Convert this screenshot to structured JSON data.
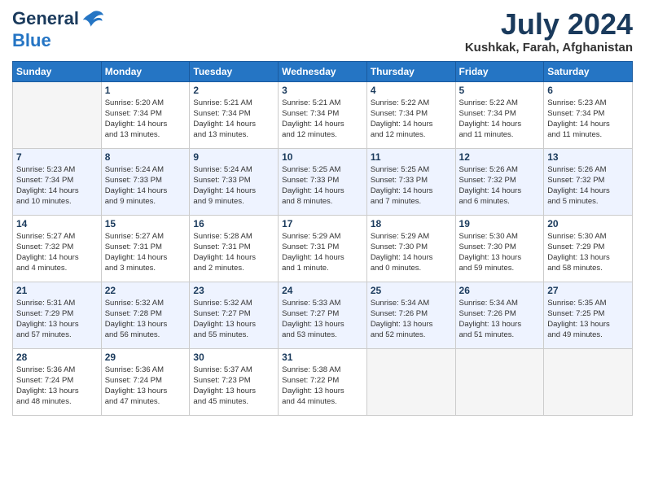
{
  "header": {
    "logo_line1": "General",
    "logo_line2": "Blue",
    "month_year": "July 2024",
    "location": "Kushkak, Farah, Afghanistan"
  },
  "days_of_week": [
    "Sunday",
    "Monday",
    "Tuesday",
    "Wednesday",
    "Thursday",
    "Friday",
    "Saturday"
  ],
  "weeks": [
    [
      {
        "day": "",
        "info": ""
      },
      {
        "day": "1",
        "info": "Sunrise: 5:20 AM\nSunset: 7:34 PM\nDaylight: 14 hours\nand 13 minutes."
      },
      {
        "day": "2",
        "info": "Sunrise: 5:21 AM\nSunset: 7:34 PM\nDaylight: 14 hours\nand 13 minutes."
      },
      {
        "day": "3",
        "info": "Sunrise: 5:21 AM\nSunset: 7:34 PM\nDaylight: 14 hours\nand 12 minutes."
      },
      {
        "day": "4",
        "info": "Sunrise: 5:22 AM\nSunset: 7:34 PM\nDaylight: 14 hours\nand 12 minutes."
      },
      {
        "day": "5",
        "info": "Sunrise: 5:22 AM\nSunset: 7:34 PM\nDaylight: 14 hours\nand 11 minutes."
      },
      {
        "day": "6",
        "info": "Sunrise: 5:23 AM\nSunset: 7:34 PM\nDaylight: 14 hours\nand 11 minutes."
      }
    ],
    [
      {
        "day": "7",
        "info": "Sunrise: 5:23 AM\nSunset: 7:34 PM\nDaylight: 14 hours\nand 10 minutes."
      },
      {
        "day": "8",
        "info": "Sunrise: 5:24 AM\nSunset: 7:33 PM\nDaylight: 14 hours\nand 9 minutes."
      },
      {
        "day": "9",
        "info": "Sunrise: 5:24 AM\nSunset: 7:33 PM\nDaylight: 14 hours\nand 9 minutes."
      },
      {
        "day": "10",
        "info": "Sunrise: 5:25 AM\nSunset: 7:33 PM\nDaylight: 14 hours\nand 8 minutes."
      },
      {
        "day": "11",
        "info": "Sunrise: 5:25 AM\nSunset: 7:33 PM\nDaylight: 14 hours\nand 7 minutes."
      },
      {
        "day": "12",
        "info": "Sunrise: 5:26 AM\nSunset: 7:32 PM\nDaylight: 14 hours\nand 6 minutes."
      },
      {
        "day": "13",
        "info": "Sunrise: 5:26 AM\nSunset: 7:32 PM\nDaylight: 14 hours\nand 5 minutes."
      }
    ],
    [
      {
        "day": "14",
        "info": "Sunrise: 5:27 AM\nSunset: 7:32 PM\nDaylight: 14 hours\nand 4 minutes."
      },
      {
        "day": "15",
        "info": "Sunrise: 5:27 AM\nSunset: 7:31 PM\nDaylight: 14 hours\nand 3 minutes."
      },
      {
        "day": "16",
        "info": "Sunrise: 5:28 AM\nSunset: 7:31 PM\nDaylight: 14 hours\nand 2 minutes."
      },
      {
        "day": "17",
        "info": "Sunrise: 5:29 AM\nSunset: 7:31 PM\nDaylight: 14 hours\nand 1 minute."
      },
      {
        "day": "18",
        "info": "Sunrise: 5:29 AM\nSunset: 7:30 PM\nDaylight: 14 hours\nand 0 minutes."
      },
      {
        "day": "19",
        "info": "Sunrise: 5:30 AM\nSunset: 7:30 PM\nDaylight: 13 hours\nand 59 minutes."
      },
      {
        "day": "20",
        "info": "Sunrise: 5:30 AM\nSunset: 7:29 PM\nDaylight: 13 hours\nand 58 minutes."
      }
    ],
    [
      {
        "day": "21",
        "info": "Sunrise: 5:31 AM\nSunset: 7:29 PM\nDaylight: 13 hours\nand 57 minutes."
      },
      {
        "day": "22",
        "info": "Sunrise: 5:32 AM\nSunset: 7:28 PM\nDaylight: 13 hours\nand 56 minutes."
      },
      {
        "day": "23",
        "info": "Sunrise: 5:32 AM\nSunset: 7:27 PM\nDaylight: 13 hours\nand 55 minutes."
      },
      {
        "day": "24",
        "info": "Sunrise: 5:33 AM\nSunset: 7:27 PM\nDaylight: 13 hours\nand 53 minutes."
      },
      {
        "day": "25",
        "info": "Sunrise: 5:34 AM\nSunset: 7:26 PM\nDaylight: 13 hours\nand 52 minutes."
      },
      {
        "day": "26",
        "info": "Sunrise: 5:34 AM\nSunset: 7:26 PM\nDaylight: 13 hours\nand 51 minutes."
      },
      {
        "day": "27",
        "info": "Sunrise: 5:35 AM\nSunset: 7:25 PM\nDaylight: 13 hours\nand 49 minutes."
      }
    ],
    [
      {
        "day": "28",
        "info": "Sunrise: 5:36 AM\nSunset: 7:24 PM\nDaylight: 13 hours\nand 48 minutes."
      },
      {
        "day": "29",
        "info": "Sunrise: 5:36 AM\nSunset: 7:24 PM\nDaylight: 13 hours\nand 47 minutes."
      },
      {
        "day": "30",
        "info": "Sunrise: 5:37 AM\nSunset: 7:23 PM\nDaylight: 13 hours\nand 45 minutes."
      },
      {
        "day": "31",
        "info": "Sunrise: 5:38 AM\nSunset: 7:22 PM\nDaylight: 13 hours\nand 44 minutes."
      },
      {
        "day": "",
        "info": ""
      },
      {
        "day": "",
        "info": ""
      },
      {
        "day": "",
        "info": ""
      }
    ]
  ]
}
